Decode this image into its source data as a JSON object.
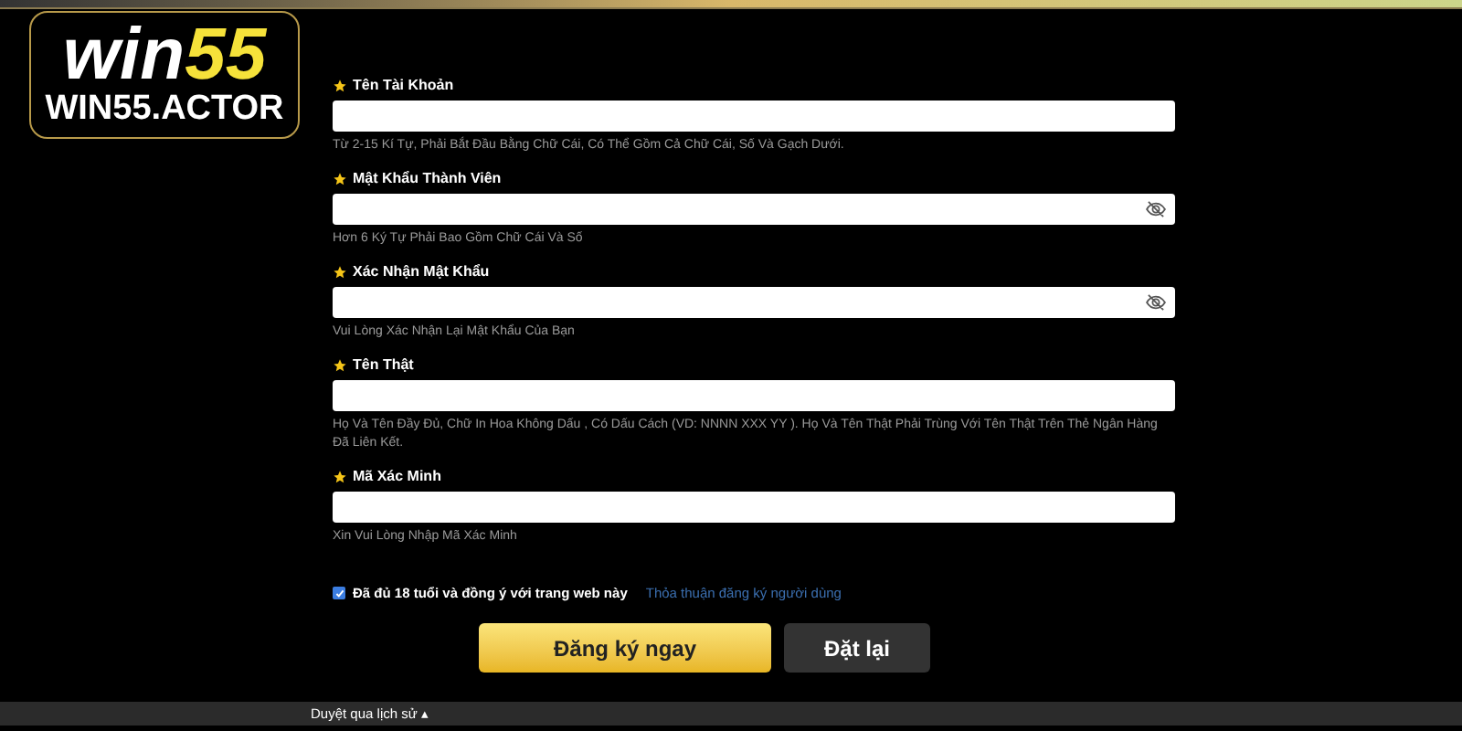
{
  "logo": {
    "word": "win",
    "number": "55",
    "domain": "WIN55.ACTOR"
  },
  "fields": [
    {
      "label": "Tên Tài Khoản",
      "required": true,
      "kind": "text",
      "hint": "Từ 2-15 Kí Tự, Phải Bắt Đầu Bằng Chữ Cái, Có Thể Gồm Cả Chữ Cái, Số Và Gạch Dưới."
    },
    {
      "label": "Mật Khẩu Thành Viên",
      "required": true,
      "kind": "password",
      "hint": "Hơn 6 Ký Tự Phải Bao Gồm Chữ Cái Và Số"
    },
    {
      "label": "Xác Nhận Mật Khẩu",
      "required": true,
      "kind": "password",
      "hint": "Vui Lòng Xác Nhận Lại Mật Khẩu Của Bạn"
    },
    {
      "label": "Tên Thật",
      "required": true,
      "kind": "text",
      "hint": "Họ Và Tên Đầy Đủ, Chữ In Hoa Không Dấu , Có Dấu Cách (VD: NNNN XXX YY ). Họ Và Tên Thật Phải Trùng Với Tên Thật Trên Thẻ Ngân Hàng Đã Liên Kết."
    },
    {
      "label": "Mã Xác Minh",
      "required": true,
      "kind": "text",
      "hint": "Xin Vui Lòng Nhập Mã Xác Minh"
    }
  ],
  "agreement": {
    "checked": true,
    "label": "Đã đủ 18 tuổi và đồng ý với trang web này",
    "link": "Thỏa thuận đăng ký người dùng"
  },
  "buttons": [
    {
      "label": "Đăng ký ngay",
      "kind": "primary"
    },
    {
      "label": "Đặt lại",
      "kind": "secondary"
    }
  ],
  "bottom_bar": {
    "label": "Duyệt qua lịch sử ▴"
  }
}
